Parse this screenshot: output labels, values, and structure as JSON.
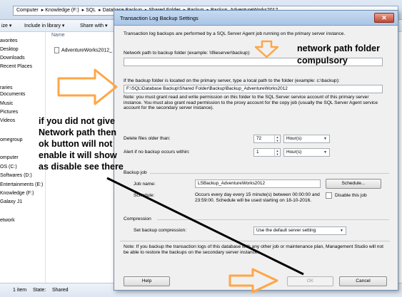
{
  "explorer": {
    "breadcrumb": [
      "Computer",
      "Knowledge (F:)",
      "SQL",
      "Database Backup",
      "Shared Folder",
      "Backup",
      "Backup_AdventureWorks2012"
    ],
    "cmd": [
      "ize ▾",
      "Include in library ▾",
      "Share with ▾"
    ],
    "nav": [
      "avorites",
      "Desktop",
      "Downloads",
      "Recent Places",
      "raries",
      "Documents",
      "Music",
      "Pictures",
      "Videos",
      "omegroup",
      "omputer",
      "OS (C:)",
      "Softwares (D:)",
      "Entertainments (E:)",
      "Knowledge (F:)",
      "Galaxy J1",
      "etwork"
    ],
    "column_name": "Name",
    "file_name": "AdventureWorks2012_",
    "right_fragment": [
      "sen",
      "led"
    ],
    "status_count": "1 item",
    "status_state": "State:",
    "status_shared": "Shared"
  },
  "dialog": {
    "title": "Transaction Log Backup Settings",
    "close": "✕",
    "intro": "Transaction log backups are performed by a SQL Server Agent job running on the primary server instance.",
    "network_label": "Network path to backup folder (example: \\\\fileserver\\backup):",
    "network_value": "",
    "local_label": "If the backup folder is located on the primary server, type a local path to the folder (example: c:\\backup):",
    "local_value": "F:\\SQL\\Database Backup\\Shared Folder\\Backup\\Backup_AdventureWorks2012",
    "note1": "Note: you must grant read and write permission on this folder to the SQL Server service account of this primary server instance.  You must also grant read permission to the proxy account for the copy job (usually the SQL Server Agent service account for the secondary server instance).",
    "delete_label": "Delete files older than:",
    "delete_value": "72",
    "delete_unit": "Hour(s)",
    "alert_label": "Alert if no backup occurs within:",
    "alert_value": "1",
    "alert_unit": "Hour(s)",
    "backup_job_label": "Backup job",
    "job_name_label": "Job name:",
    "job_name_value": "LSBackup_AdventureWorks2012",
    "schedule_button": "Schedule...",
    "schedule_label": "Schedule:",
    "schedule_value": "Occurs every day every 15 minute(s) between 00:00:00 and 23:59:00. Schedule will be used starting on 18-10-2016.",
    "disable_job": "Disable this job",
    "compression_label": "Compression",
    "set_compression_label": "Set backup compression:",
    "compression_value": "Use the default server setting",
    "note2": "Note: If you backup the transaction logs of this database with any other job or maintenance plan, Management Studio will not be able to restore the backups on the secondary server instances.",
    "help_button": "Help",
    "ok_button": "OK",
    "cancel_button": "Cancel"
  },
  "annotations": {
    "top_right": "network path folder compulsory",
    "left": "if you did not give Network path then ok button will not enable it will show as disable see there",
    "arrow_color": "#ffa646",
    "line_color": "#000000"
  }
}
